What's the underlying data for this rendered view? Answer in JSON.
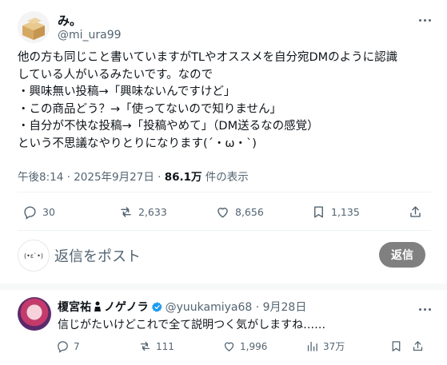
{
  "post": {
    "author_name": "み。",
    "author_handle": "@mi_ura99",
    "body": "他の方も同じこと書いていますがTLやオススメを自分宛DMのように認識\nしている人がいるみたいです。なので\n・興味無い投稿→「興味ないんですけど」\n・この商品どう？→「使ってないので知りません」\n・自分が不快な投稿→「投稿やめて」（DM送るなの感覚）\nという不思議なやりとりになります(´・ω・`)",
    "time": "午後8:14 · 2025年9月27日 · ",
    "views_count": "86.1万",
    "views_label": " 件の表示",
    "stats": {
      "replies": "30",
      "reposts": "2,633",
      "likes": "8,656",
      "bookmarks": "1,135"
    }
  },
  "composer": {
    "avatar_text": "(•ε`•)",
    "placeholder": "返信をポスト",
    "button_label": "返信"
  },
  "reply": {
    "name": "榎宮祐",
    "name_suffix": "ノゲノラ",
    "handle_time": "@yuukamiya68 · 9月28日",
    "text": "信じがたいけどこれで全て説明つく気がしますね……",
    "stats": {
      "replies": "7",
      "reposts": "111",
      "likes": "1,996",
      "views": "37万"
    }
  },
  "colors": {
    "text": "#0f1419",
    "muted": "#536471",
    "divider": "#eff3f4",
    "verified": "#1d9bf0",
    "reply_button": "#808080"
  }
}
